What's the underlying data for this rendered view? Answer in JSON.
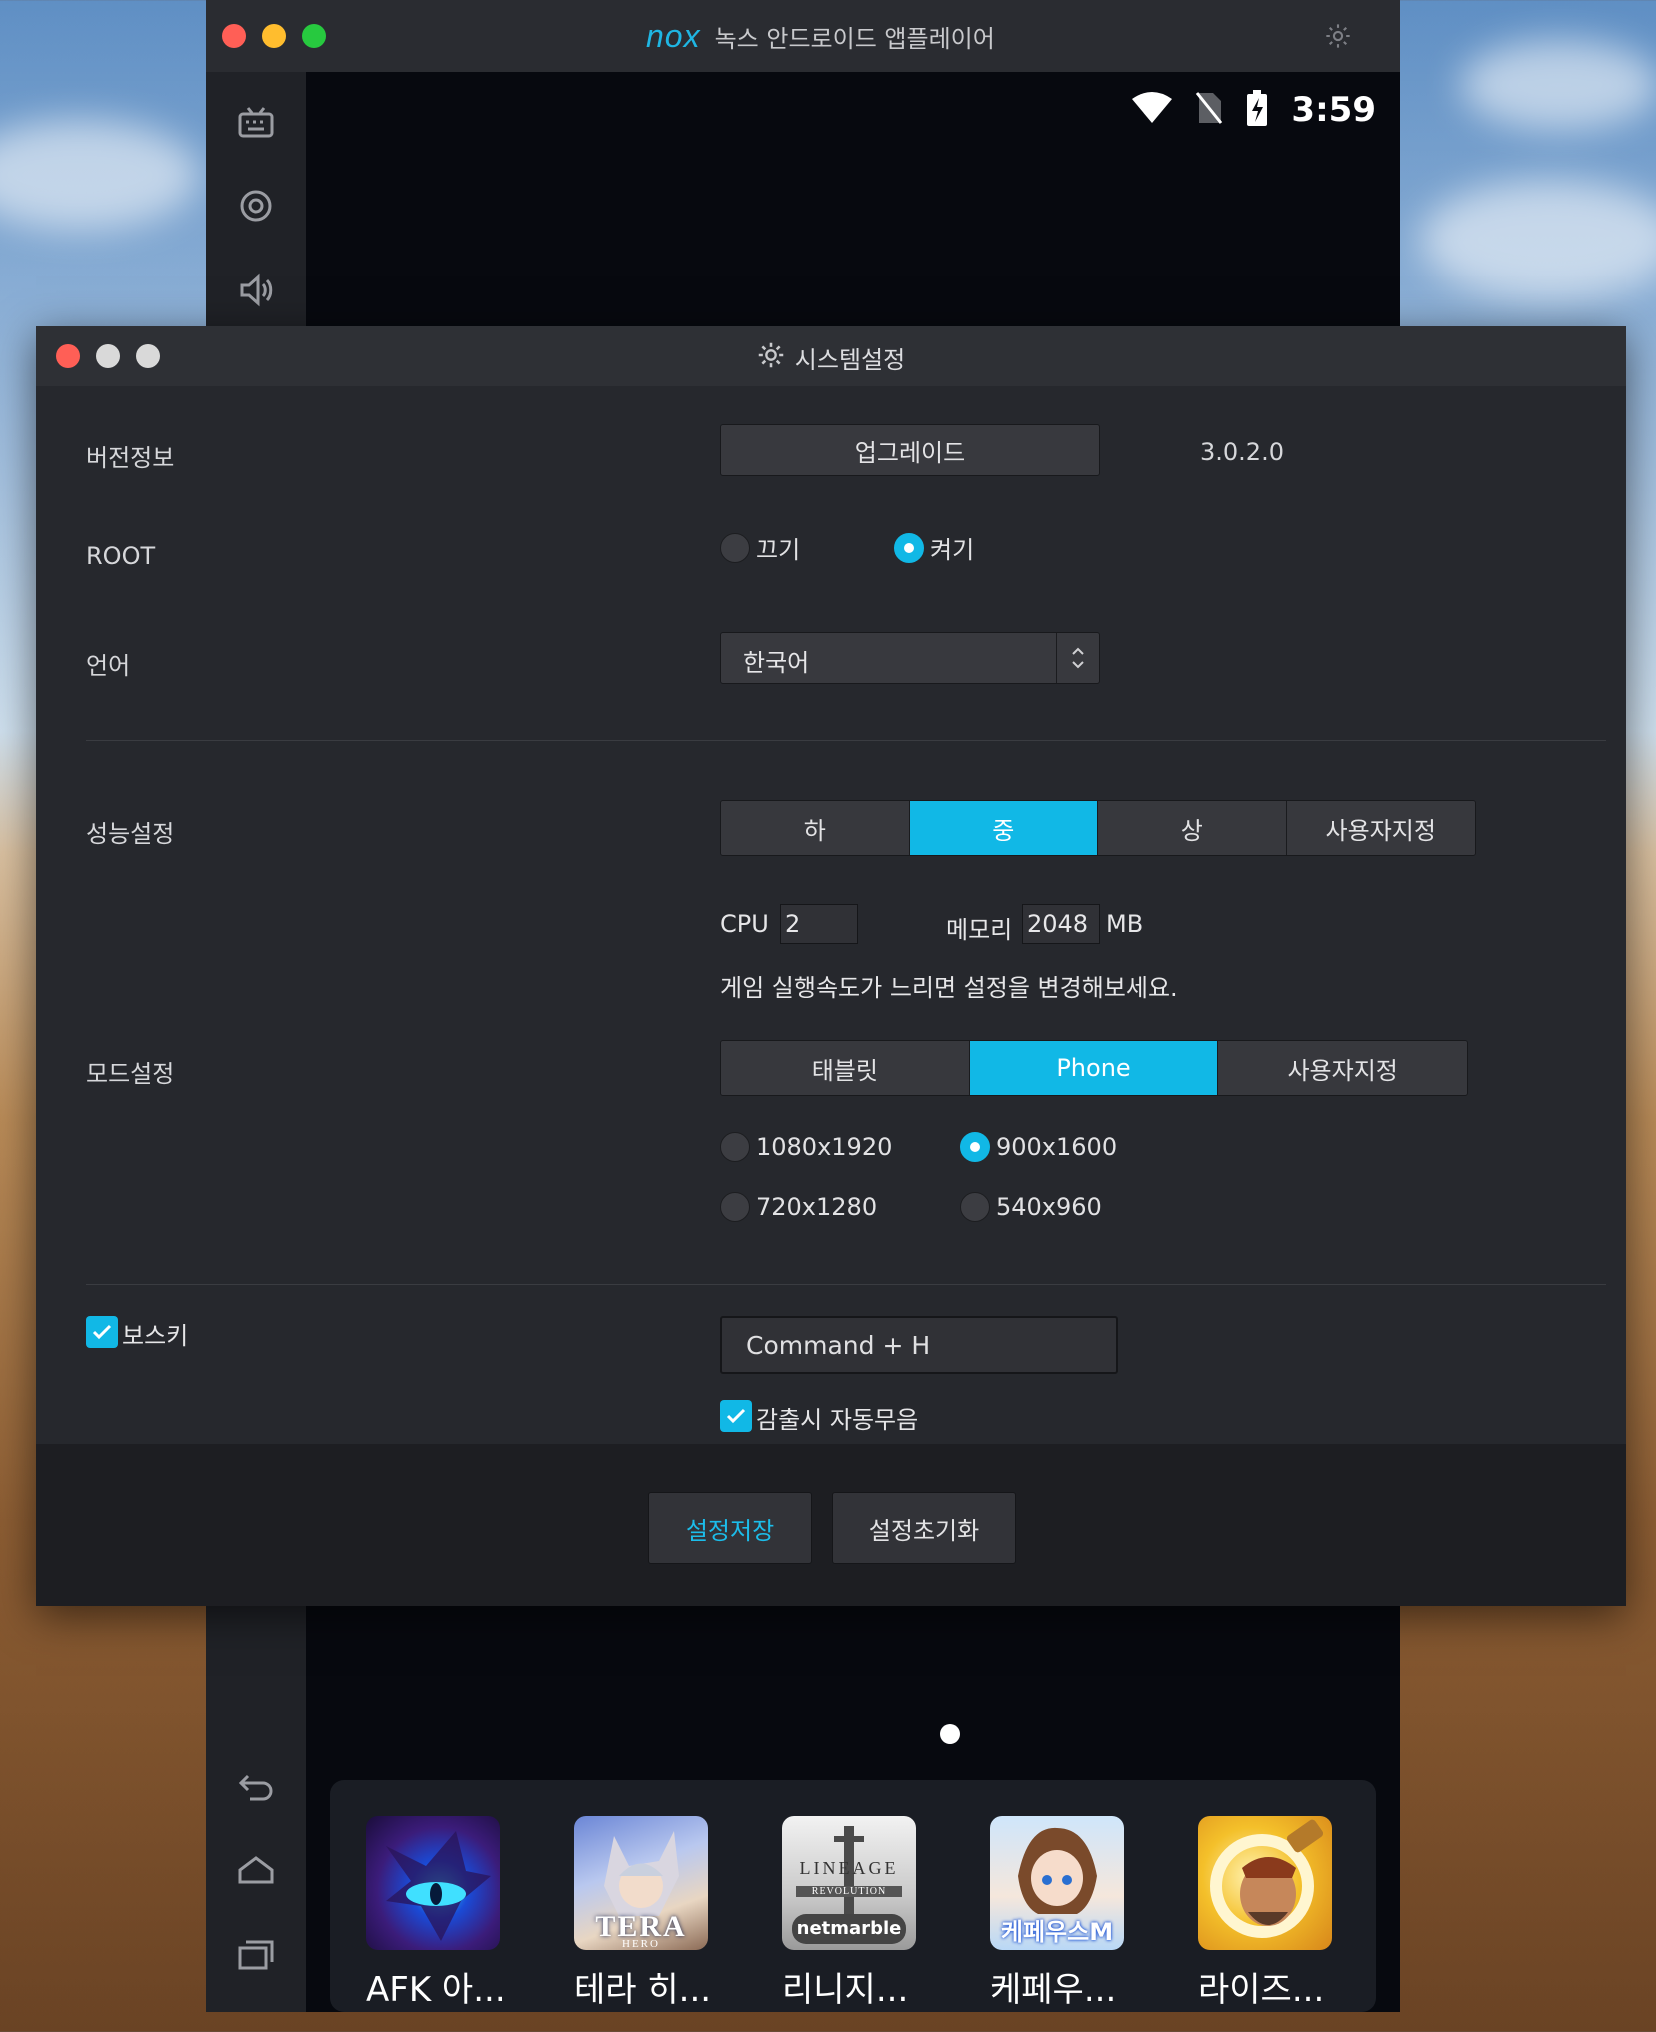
{
  "nox": {
    "logo": "nox",
    "title": "녹스 안드로이드 앱플레이어",
    "status": {
      "time": "3:59"
    },
    "dock_apps": [
      {
        "label": "AFK 아..."
      },
      {
        "label": "테라 히..."
      },
      {
        "label": "리니지..."
      },
      {
        "label": "케페우..."
      },
      {
        "label": "라이즈..."
      }
    ],
    "app_icon_text": {
      "tera": "TERA",
      "tera_sub": "HERO",
      "lineage": "LINEAGE",
      "lineage_sub": "REVOLUTION",
      "lineage_brand": "netmarble",
      "kepheu": "케페우스M"
    }
  },
  "dialog": {
    "title": "시스템설정",
    "version": {
      "label": "버전정보",
      "upgrade_button": "업그레이드",
      "version_number": "3.0.2.0"
    },
    "root": {
      "label": "ROOT",
      "off_label": "끄기",
      "on_label": "켜기",
      "selected": "on"
    },
    "language": {
      "label": "언어",
      "selected": "한국어"
    },
    "performance": {
      "label": "성능설정",
      "options": [
        "하",
        "중",
        "상",
        "사용자지정"
      ],
      "selected": "중",
      "cpu_label": "CPU",
      "cpu_value": "2",
      "memory_label": "메모리",
      "memory_value": "2048",
      "memory_unit": "MB",
      "hint": "게임 실행속도가 느리면 설정을 변경해보세요."
    },
    "mode": {
      "label": "모드설정",
      "options": [
        "태블릿",
        "Phone",
        "사용자지정"
      ],
      "selected": "Phone",
      "resolutions": [
        "1080x1920",
        "900x1600",
        "720x1280",
        "540x960"
      ],
      "selected_resolution": "900x1600"
    },
    "boss_key": {
      "label": "보스키",
      "checked": true,
      "shortcut": "Command + H",
      "auto_mute_label": "감출시 자동무음",
      "auto_mute_checked": true
    },
    "footer": {
      "save_label": "설정저장",
      "reset_label": "설정초기화"
    }
  },
  "colors": {
    "accent": "#11b8e6",
    "dialog_bg": "#26282d",
    "footer_bg": "#1d1e22"
  }
}
